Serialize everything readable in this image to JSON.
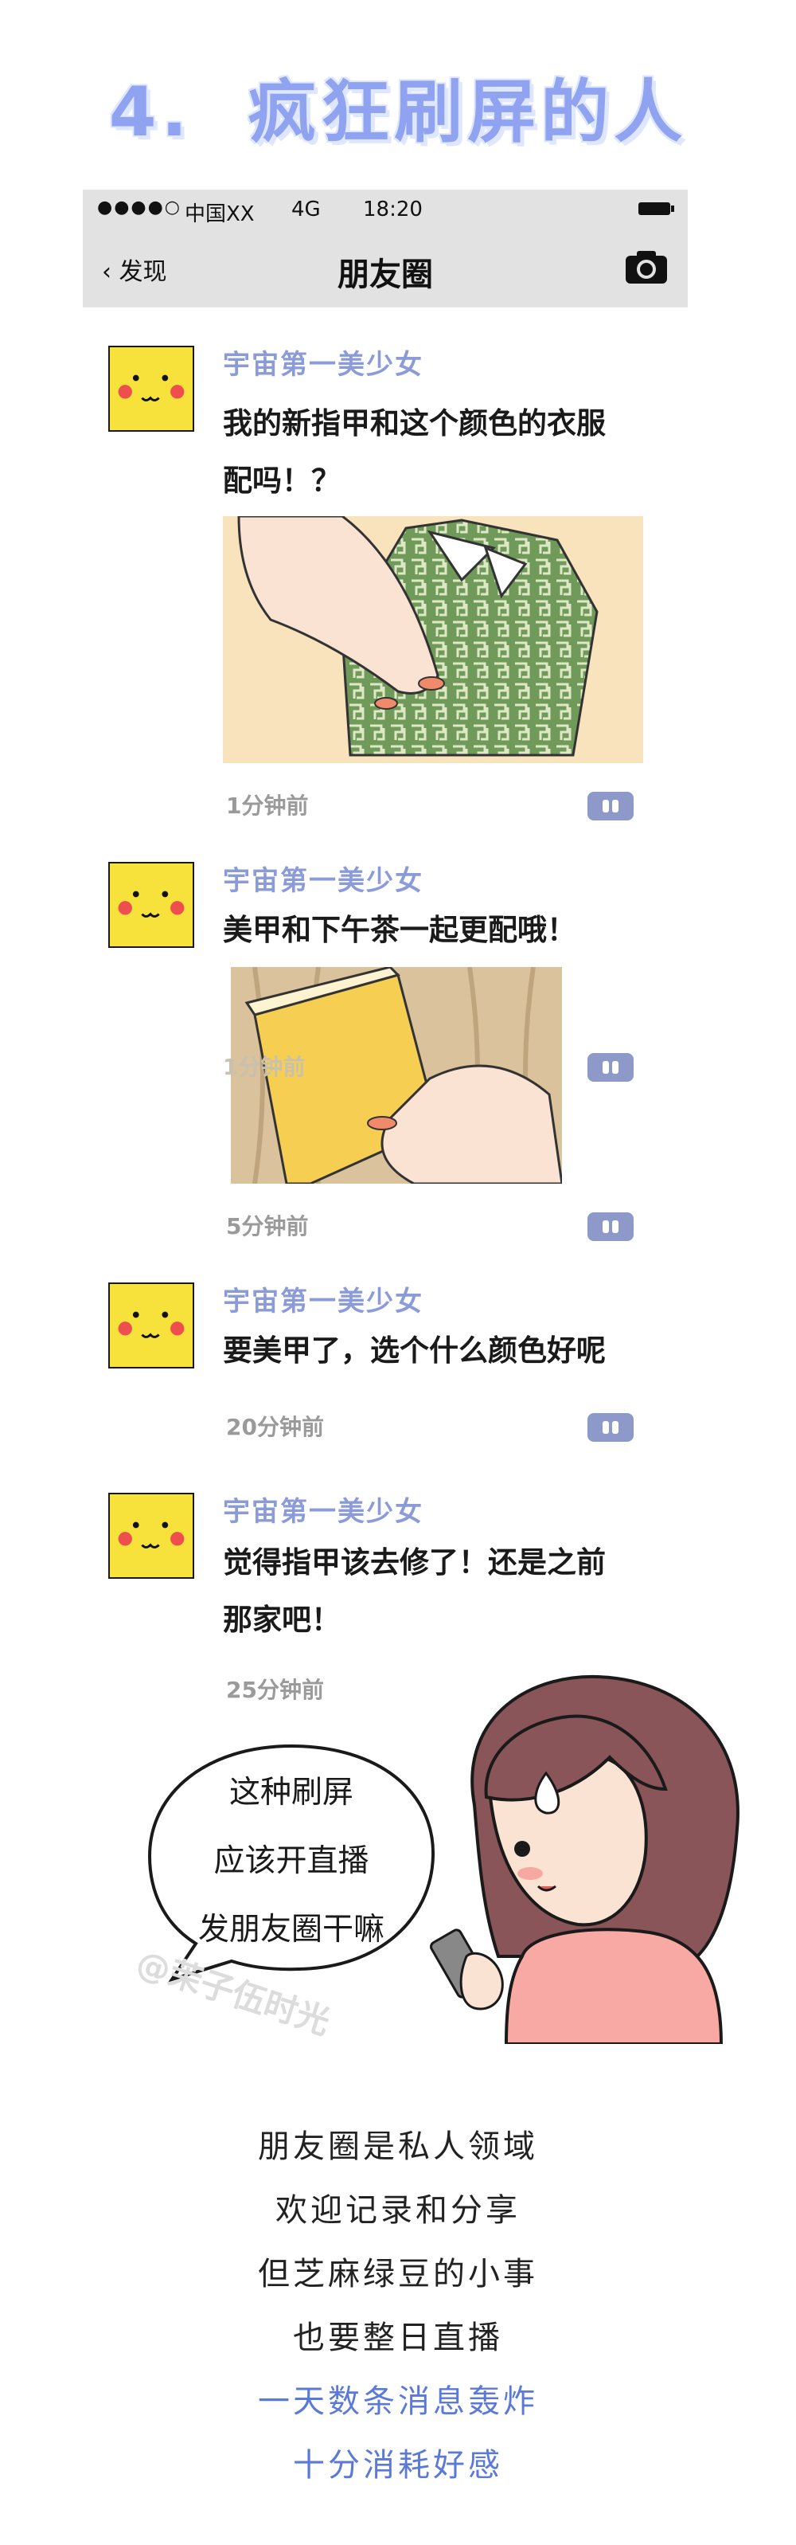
{
  "section_title": {
    "number": "4.",
    "text": "疯狂刷屏的人"
  },
  "status_bar": {
    "signal": "●●●●○",
    "carrier": "中国XX",
    "network": "4G",
    "time": "18:20"
  },
  "nav_bar": {
    "back_label": "发现",
    "title": "朋友圈"
  },
  "posts": [
    {
      "author": "宇宙第一美少女",
      "text_line1": "我的新指甲和这个颜色的衣服",
      "text_line2": "配吗！？",
      "time": "1分钟前"
    },
    {
      "author": "宇宙第一美少女",
      "text_line1": "美甲和下午茶一起更配哦！",
      "time": "5分钟前",
      "overlay_time": "1分钟前"
    },
    {
      "author": "宇宙第一美少女",
      "text_line1": "要美甲了，选个什么颜色好呢",
      "time": "20分钟前"
    },
    {
      "author": "宇宙第一美少女",
      "text_line1": "觉得指甲该去修了！还是之前",
      "text_line2": "那家吧！",
      "time": "25分钟前"
    }
  ],
  "bubble": {
    "line1": "这种刷屏",
    "line2": "应该开直播",
    "line3": "发朋友圈干嘛"
  },
  "watermark": "@茉子伍时光",
  "ending": [
    "朋友圈是私人领域",
    "欢迎记录和分享",
    "但芝麻绿豆的小事",
    "也要整日直播"
  ],
  "ending_highlight": [
    "一天数条消息轰炸",
    "十分消耗好感"
  ],
  "colors": {
    "accent": "#8fa3f0",
    "author": "#8b9bd8",
    "highlight": "#5b79d9",
    "comment_button": "#8c99c9",
    "avatar": "#f7e23b"
  }
}
